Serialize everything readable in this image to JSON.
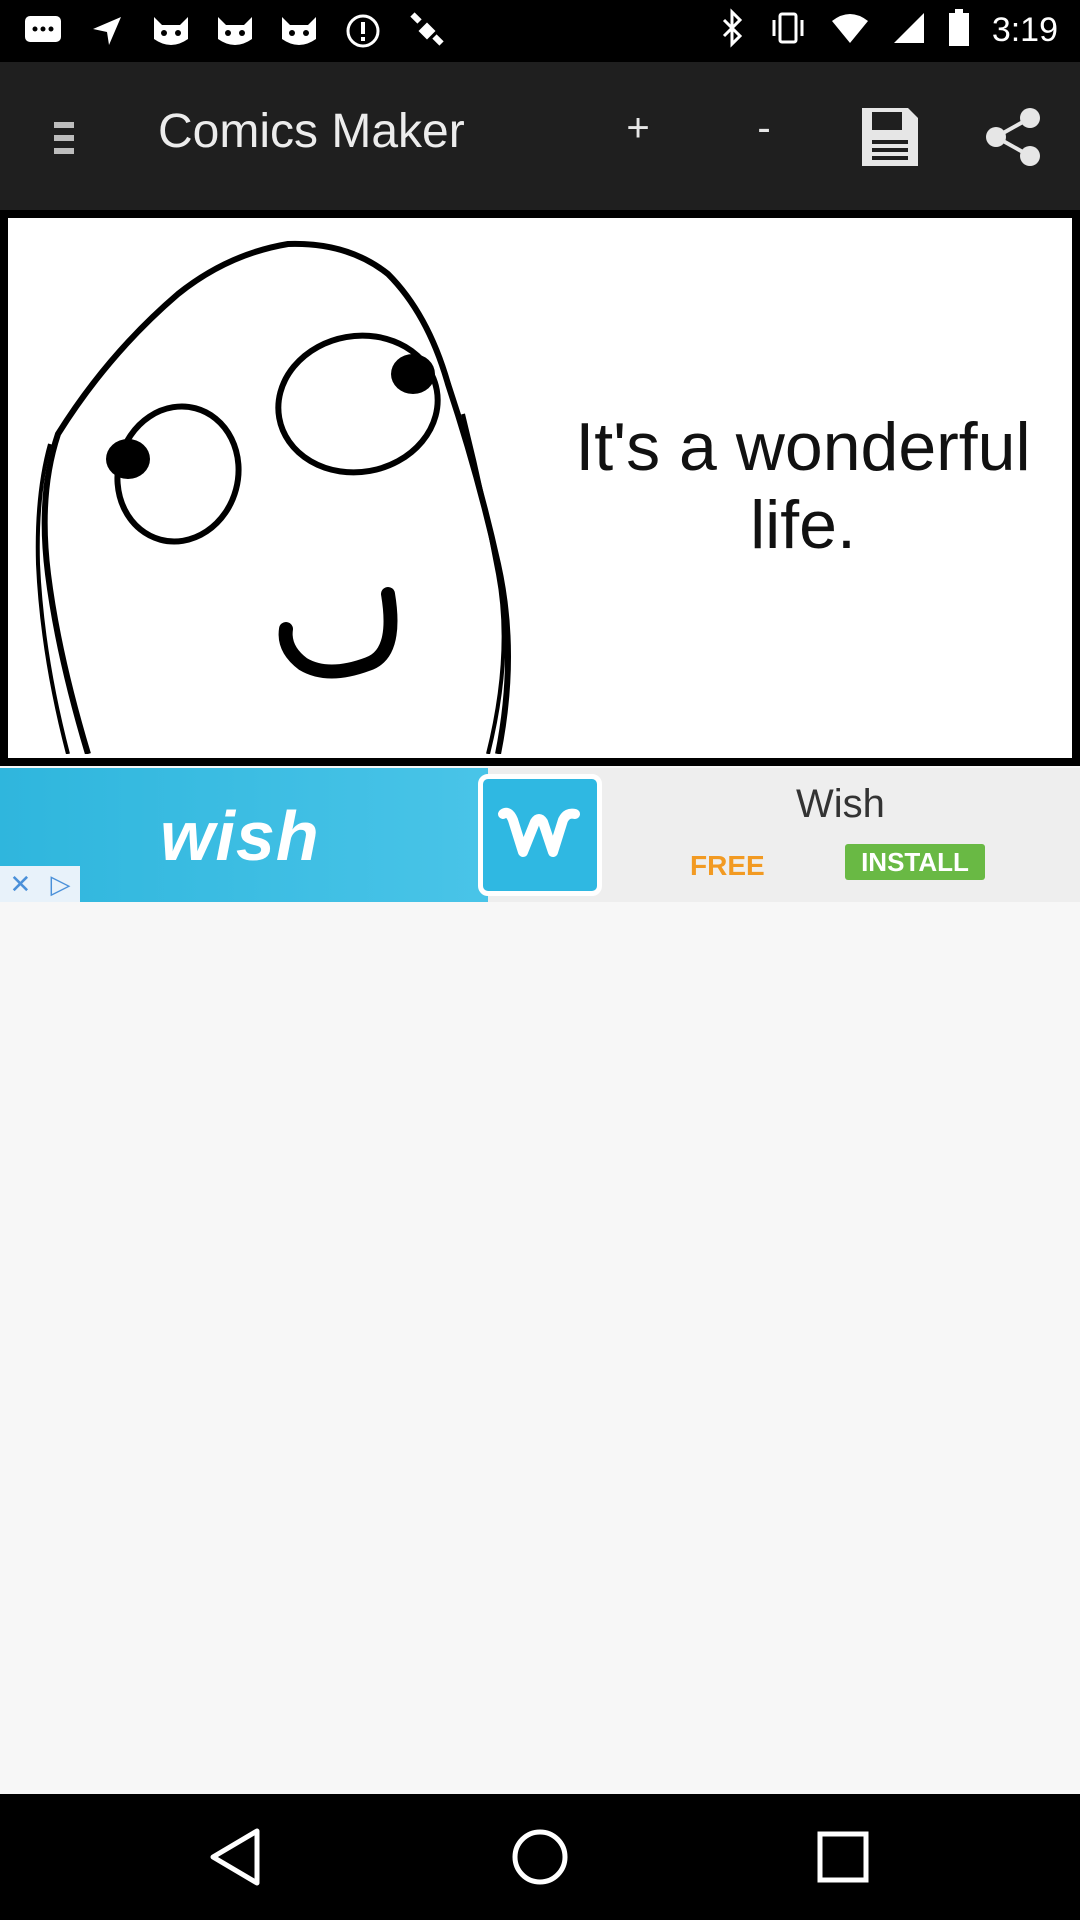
{
  "status_bar": {
    "time": "3:19",
    "icons": [
      "message-icon",
      "navigation-icon",
      "cat-face-icon",
      "cat-face-icon",
      "cat-face-icon",
      "alert-icon",
      "satellite-icon",
      "bluetooth-icon",
      "vibrate-icon",
      "wifi-icon",
      "signal-icon",
      "battery-icon"
    ]
  },
  "app_bar": {
    "title": "Comics Maker",
    "plus_label": "+",
    "minus_label": "-",
    "icons": [
      "menu-icon",
      "save-icon",
      "share-icon"
    ]
  },
  "comic": {
    "text": "It's a wonderful life.",
    "character": "derp-face"
  },
  "ad": {
    "brand": "wish",
    "title": "Wish",
    "free_label": "FREE",
    "install_label": "INSTALL",
    "colors": {
      "banner": "#2fb6dd",
      "install": "#69b944",
      "free": "#f29a22"
    }
  },
  "nav_bar": {
    "icons": [
      "back-icon",
      "home-icon",
      "recent-apps-icon"
    ]
  }
}
